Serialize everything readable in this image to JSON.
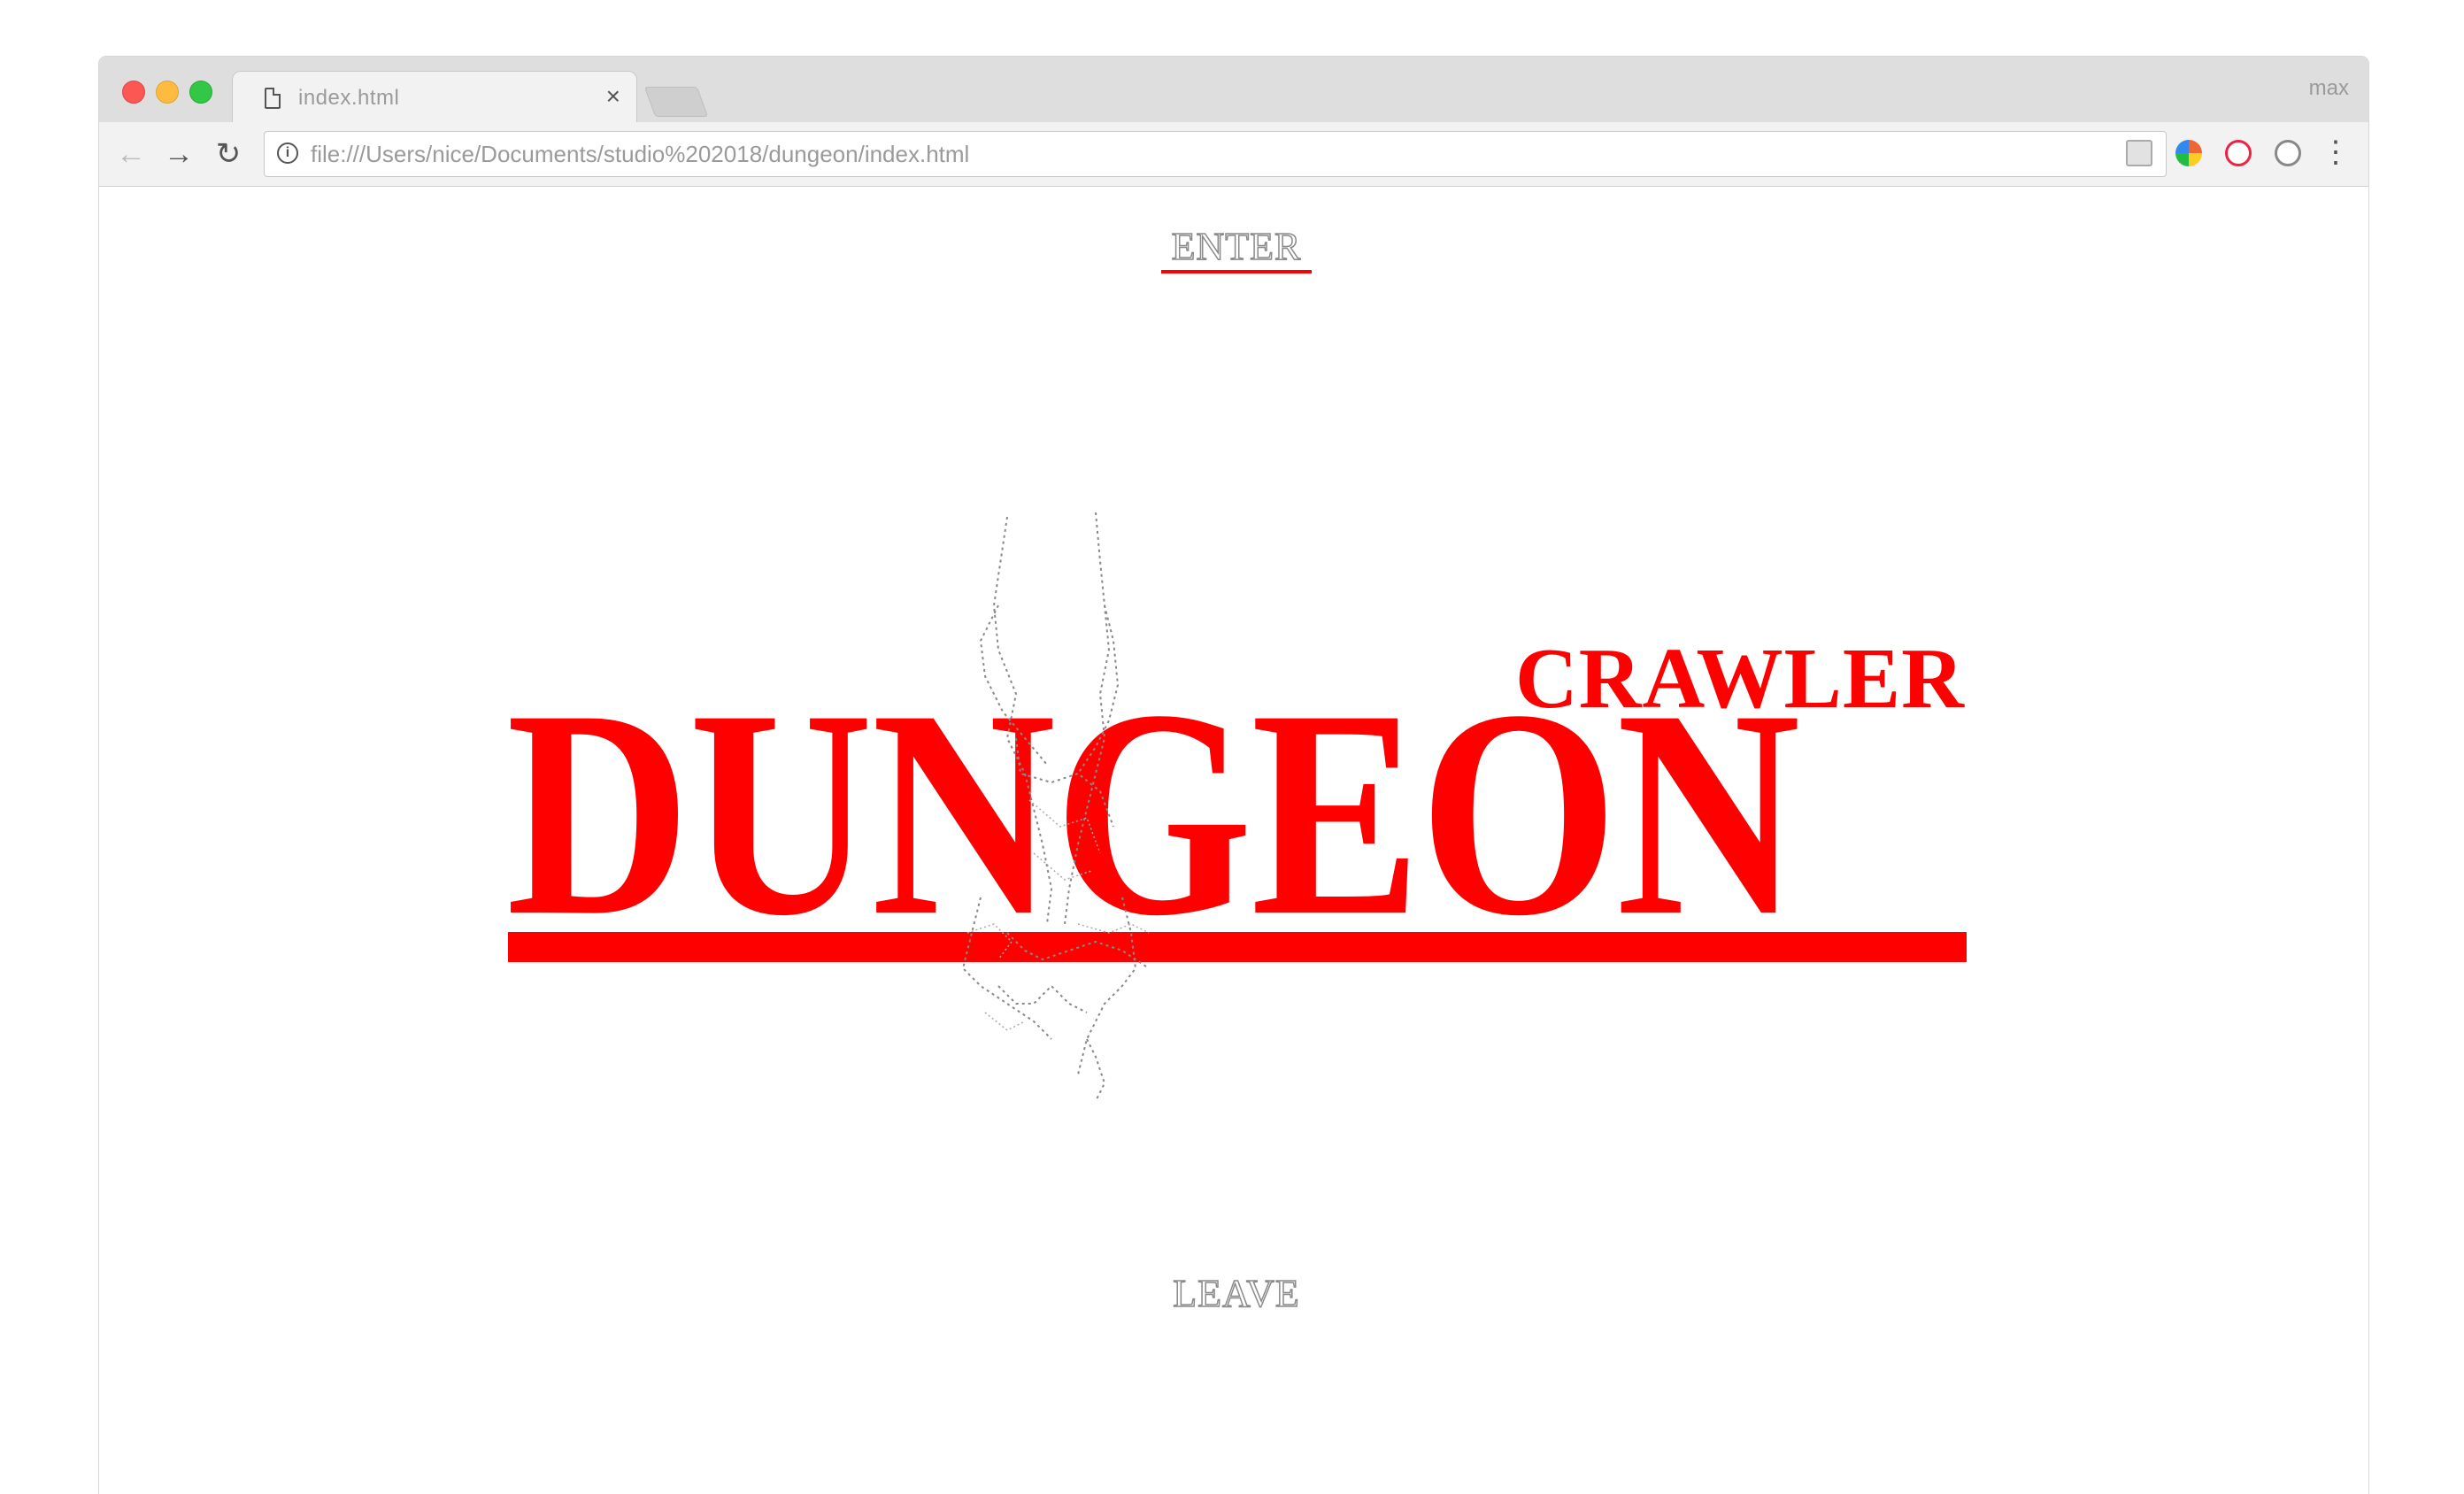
{
  "browser": {
    "tab_title": "index.html",
    "tab_close_glyph": "×",
    "profile_name": "max",
    "url": "file:///Users/nice/Documents/studio%202018/dungeon/index.html",
    "icons": {
      "back": "arrow-left-icon",
      "forward": "arrow-right-icon",
      "reload": "reload-icon",
      "info": "info-icon",
      "bookmark": "star-icon",
      "menu": "kebab-menu-icon"
    },
    "back_glyph": "←",
    "forward_glyph": "→",
    "reload_glyph": "↻",
    "info_glyph": "i",
    "star_glyph": "☆",
    "menu_glyph": "⋮"
  },
  "page": {
    "enter_label": "ENTER",
    "leave_label": "LEAVE",
    "logo": {
      "subtitle": "CRAWLER",
      "title": "DUNGEON"
    },
    "colors": {
      "accent": "#ff0000",
      "outline_text": "#8a8a8a",
      "background": "#ffffff"
    }
  }
}
